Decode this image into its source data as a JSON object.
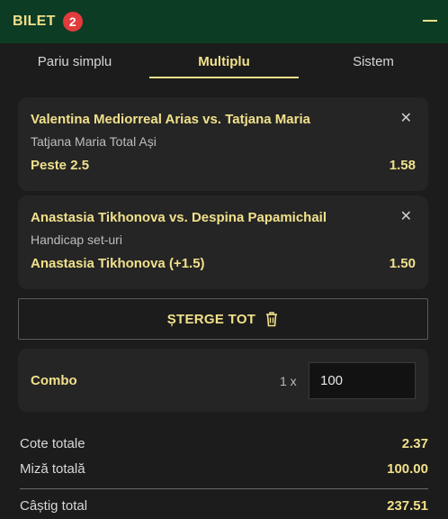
{
  "header": {
    "title": "BILET",
    "badge_count": "2",
    "collapse_icon": "minus-icon"
  },
  "tabs": [
    {
      "label": "Pariu simplu",
      "active": false
    },
    {
      "label": "Multiplu",
      "active": true
    },
    {
      "label": "Sistem",
      "active": false
    }
  ],
  "bets": [
    {
      "match": "Valentina Mediorreal Arias vs. Tatjana Maria",
      "market": "Tatjana Maria Total Ași",
      "selection": "Peste 2.5",
      "odd": "1.58",
      "close_icon": "close-icon"
    },
    {
      "match": "Anastasia Tikhonova vs. Despina Papamichail",
      "market": "Handicap set-uri",
      "selection": "Anastasia Tikhonova (+1.5)",
      "odd": "1.50",
      "close_icon": "close-icon"
    }
  ],
  "clear_all": {
    "label": "ȘTERGE TOT",
    "icon": "trash-icon"
  },
  "combo": {
    "label": "Combo",
    "multiplier": "1 x",
    "stake_value": "100"
  },
  "summary": {
    "total_odds_label": "Cote totale",
    "total_odds_value": "2.37",
    "total_stake_label": "Miză totală",
    "total_stake_value": "100.00",
    "total_win_label": "Câștig total",
    "total_win_value": "237.51"
  },
  "colors": {
    "header_bg": "#0d3c24",
    "accent": "#f1e08b",
    "badge": "#e23b3b",
    "background": "#1c1c1c",
    "card": "#252525"
  }
}
